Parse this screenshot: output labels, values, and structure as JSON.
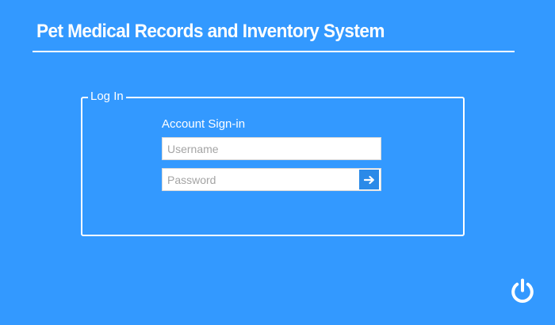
{
  "header": {
    "title": "Pet Medical Records and Inventory System"
  },
  "login": {
    "legend": "Log In",
    "heading": "Account Sign-in",
    "username_placeholder": "Username",
    "username_value": "",
    "password_placeholder": "Password",
    "password_value": "",
    "submit_icon": "arrow-right-icon"
  },
  "footer": {
    "power_icon": "power-icon"
  },
  "colors": {
    "background": "#3399ff",
    "text": "#ffffff",
    "submit_button": "#2b8ae8",
    "input_background": "#ffffff",
    "placeholder": "#a4a4a4"
  }
}
